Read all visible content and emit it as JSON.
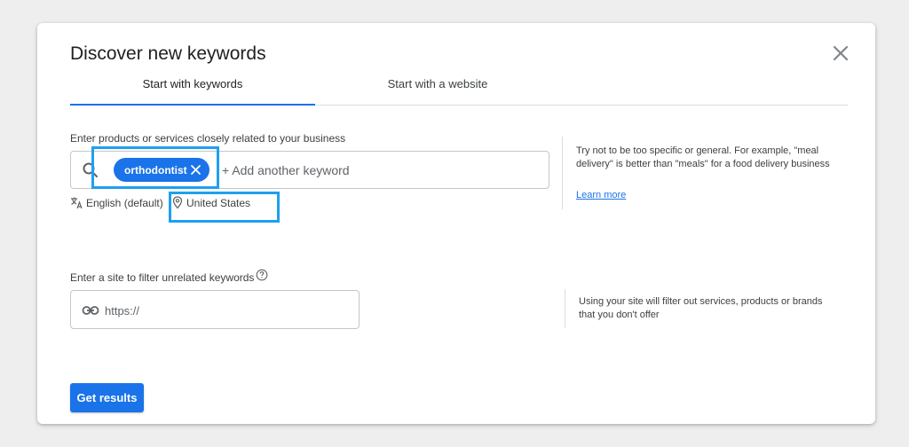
{
  "dialog": {
    "title": "Discover new keywords",
    "close_icon": "close-icon"
  },
  "tabs": [
    {
      "label": "Start with keywords",
      "active": true
    },
    {
      "label": "Start with a website",
      "active": false
    }
  ],
  "keywords": {
    "label": "Enter products or services closely related to your business",
    "chips": [
      "orthodontist"
    ],
    "placeholder": "+ Add another keyword",
    "language": "English (default)",
    "location": "United States",
    "help_text": "Try not to be too specific or general. For example, \"meal delivery\" is better than \"meals\" for a food delivery business",
    "learn_more": "Learn more"
  },
  "site": {
    "label": "Enter a site to filter unrelated keywords",
    "placeholder": "https://",
    "help_text": "Using your site will filter out services, products or brands that you don't offer"
  },
  "actions": {
    "get_results": "Get results"
  },
  "colors": {
    "accent": "#1a73e8",
    "highlight": "#1ea0f0",
    "background": "#eeeeef"
  }
}
